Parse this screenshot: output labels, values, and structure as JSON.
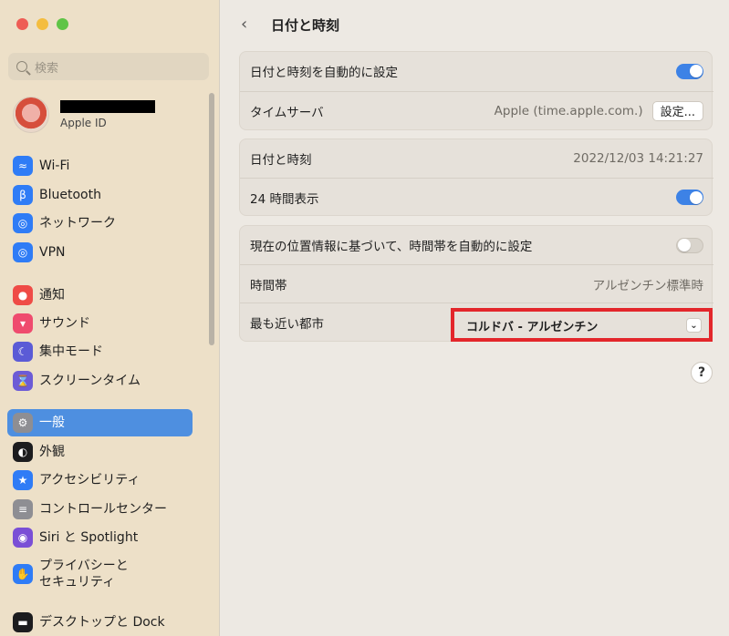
{
  "sidebar": {
    "search_placeholder": "検索",
    "profile": {
      "subtitle": "Apple ID"
    },
    "items": [
      {
        "label": "Wi-Fi",
        "icon": "wifi-icon",
        "color": "#2f7cf6"
      },
      {
        "label": "Bluetooth",
        "icon": "bluetooth-icon",
        "color": "#2f7cf6"
      },
      {
        "label": "ネットワーク",
        "icon": "globe-icon",
        "color": "#2f7cf6"
      },
      {
        "label": "VPN",
        "icon": "vpn-icon",
        "color": "#2f7cf6"
      },
      {
        "label": "通知",
        "icon": "bell-icon",
        "color": "#ef4b46"
      },
      {
        "label": "サウンド",
        "icon": "speaker-icon",
        "color": "#ef4b6e"
      },
      {
        "label": "集中モード",
        "icon": "moon-icon",
        "color": "#5b5bd6"
      },
      {
        "label": "スクリーンタイム",
        "icon": "hourglass-icon",
        "color": "#6c5bd6"
      },
      {
        "label": "一般",
        "icon": "gear-icon",
        "color": "#8e8e93"
      },
      {
        "label": "外観",
        "icon": "appearance-icon",
        "color": "#1c1c1e"
      },
      {
        "label": "アクセシビリティ",
        "icon": "accessibility-icon",
        "color": "#2f7cf6"
      },
      {
        "label": "コントロールセンター",
        "icon": "control-center-icon",
        "color": "#8e8e93"
      },
      {
        "label": "Siri と Spotlight",
        "icon": "siri-icon",
        "color": "#7a4fd6"
      },
      {
        "label": "プライバシーと\nセキュリティ",
        "icon": "hand-icon",
        "color": "#2f7cf6"
      },
      {
        "label": "デスクトップと Dock",
        "icon": "dock-icon",
        "color": "#1c1c1e"
      }
    ],
    "active_index": 8
  },
  "main": {
    "title": "日付と時刻",
    "auto_set_label": "日付と時刻を自動的に設定",
    "auto_set_on": true,
    "time_server_label": "タイムサーバ",
    "time_server_value": "Apple (time.apple.com.)",
    "set_button": "設定...",
    "datetime_label": "日付と時刻",
    "datetime_value": "2022/12/03 14:21:27",
    "hour24_label": "24 時間表示",
    "hour24_on": true,
    "tz_auto_label": "現在の位置情報に基づいて、時間帯を自動的に設定",
    "tz_auto_on": false,
    "timezone_label": "時間帯",
    "timezone_value": "アルゼンチン標準時",
    "nearest_city_label": "最も近い都市",
    "nearest_city_value": "コルドバ - アルゼンチン",
    "help": "?"
  },
  "colors": {
    "accent": "#3d82e6",
    "highlight_border": "#e3262b"
  }
}
